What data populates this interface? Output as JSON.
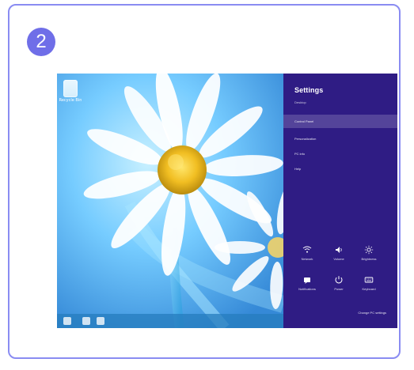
{
  "card": {
    "step_number": "2"
  },
  "colors": {
    "card_border": "#8a8cf2",
    "badge": "#6f6ee8",
    "settings_background": "#2f1c84"
  },
  "desktop": {
    "icon_label": "Recycle Bin",
    "taskbar_icons": [
      "start-icon",
      "file-explorer-icon",
      "browser-icon"
    ]
  },
  "settings_panel": {
    "title": "Settings",
    "subtitle": "Desktop",
    "items": [
      "Control Panel",
      "Personalization",
      "PC info",
      "Help"
    ],
    "icons": [
      {
        "name": "network-icon",
        "label": "Network"
      },
      {
        "name": "volume-icon",
        "label": "Volume"
      },
      {
        "name": "brightness-icon",
        "label": "Brightness"
      },
      {
        "name": "notifications-icon",
        "label": "Notifications"
      },
      {
        "name": "power-icon",
        "label": "Power"
      },
      {
        "name": "keyboard-icon",
        "label": "Keyboard"
      }
    ],
    "footer_link": "Change PC settings"
  }
}
